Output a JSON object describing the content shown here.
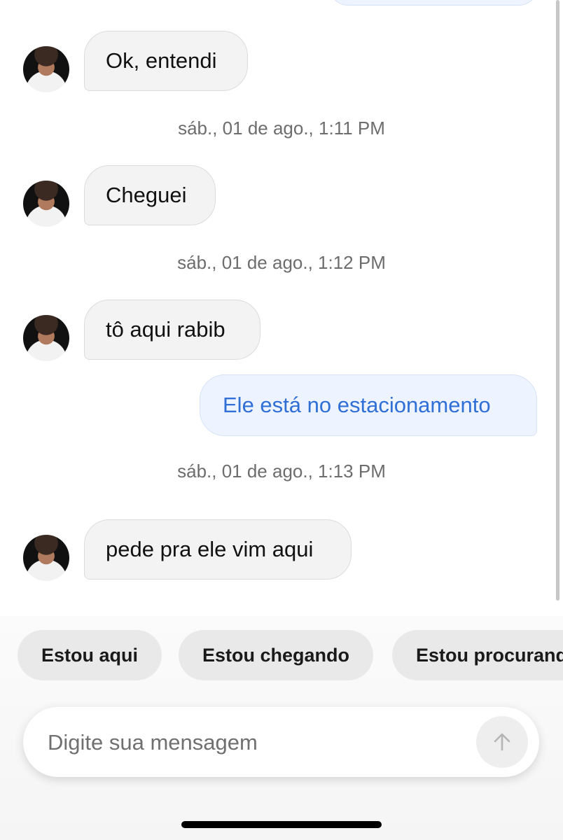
{
  "messages": [
    {
      "side": "in",
      "text": "Ok, entendi"
    },
    {
      "type": "timestamp",
      "text": "sáb., 01 de ago., 1:11 PM"
    },
    {
      "side": "in",
      "text": "Cheguei"
    },
    {
      "type": "timestamp",
      "text": "sáb., 01 de ago., 1:12 PM"
    },
    {
      "side": "in",
      "text": "tô aqui rabib"
    },
    {
      "side": "out",
      "text": "Ele está no estacionamento"
    },
    {
      "type": "timestamp",
      "text": "sáb., 01 de ago., 1:13 PM"
    },
    {
      "side": "in",
      "text": "pede pra ele vim aqui"
    }
  ],
  "quick_replies": [
    "Estou aqui",
    "Estou chegando",
    "Estou procurando"
  ],
  "composer": {
    "placeholder": "Digite sua mensagem",
    "send_icon": "arrow-up-icon"
  },
  "colors": {
    "outgoing_text": "#2f6fd6",
    "outgoing_bg": "#eef4ff",
    "incoming_bg": "#f3f3f3"
  }
}
